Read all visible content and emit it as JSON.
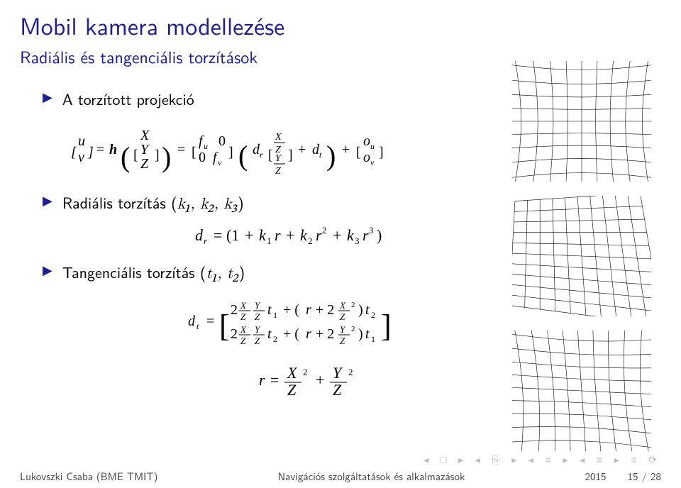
{
  "title": "Mobil kamera modellezése",
  "subtitle": "Radiális és tangenciális torzítások",
  "bullets": {
    "b1": "A torzított projekció",
    "b2_pre": "Radiális torzítás (",
    "b2_k": "k₁, k₂, k₃",
    "b2_post": ")",
    "b3_pre": "Tangenciális torzítás (",
    "b3_t": "t₁, t₂",
    "b3_post": ")"
  },
  "equations": {
    "proj": "[u v]ᵀ = h([X Y Z]ᵀ) = [fᵤ 0; 0 fᵥ] ( d_r [X/Z; Y/Z] + d_t ) + [oᵤ; oᵥ]",
    "dr": "d_r = (1 + k₁ r + k₂ r² + k₃ r³)",
    "dt": "d_t = [ 2 (X/Z)(Y/Z) t₁ + (r + 2 (X/Z)²) t₂ ;  2 (X/Z)(Y/Z) t₂ + (r + 2 (Y/Z)²) t₁ ]",
    "r": "r = (X/Z)² + (Y/Z)²"
  },
  "footer": {
    "left": "Lukovszki Csaba (BME TMIT)",
    "center": "Navigációs szolgáltatások és alkalmazások",
    "right_year": "2015",
    "right_page": "15 / 28"
  },
  "chart_data": [
    {
      "type": "heatmap",
      "title": "radial distortion grid (barrel/pincushion warp illustration)",
      "grid_lines": 11,
      "distortion": "barrel"
    },
    {
      "type": "heatmap",
      "title": "tangential distortion grid (shear/skew warp illustration)",
      "grid_lines": 11,
      "distortion": "tangential"
    },
    {
      "type": "heatmap",
      "title": "combined distortion grid illustration",
      "grid_lines": 11,
      "distortion": "combined"
    }
  ]
}
